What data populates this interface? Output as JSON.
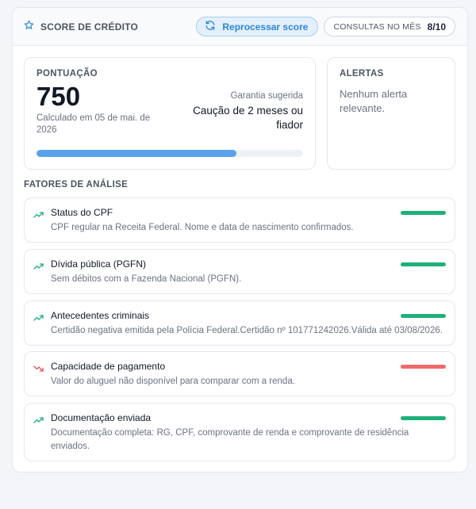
{
  "header": {
    "title": "SCORE DE CRÉDITO",
    "reprocess_label": "Reprocessar score",
    "consult_label": "CONSULTAS NO MÊS",
    "consult_value": "8/10"
  },
  "score": {
    "label": "PONTUAÇÃO",
    "value": "750",
    "date": "Calculado em 05 de mai. de 2026",
    "guarantee_label": "Garantia sugerida",
    "guarantee_value": "Caução de 2 meses ou fiador",
    "progress": 0.75
  },
  "alerts": {
    "label": "ALERTAS",
    "text": "Nenhum alerta relevante."
  },
  "factors_title": "FATORES DE ANÁLISE",
  "factors": [
    {
      "name": "Status do CPF",
      "desc": "CPF regular na Receita Federal. Nome e data de nascimento confirmados.",
      "trend": "up",
      "status_color": "#1fb07a"
    },
    {
      "name": "Dívida pública (PGFN)",
      "desc": "Sem débitos com a Fazenda Nacional (PGFN).",
      "trend": "up",
      "status_color": "#1fb07a"
    },
    {
      "name": "Antecedentes criminais",
      "desc": "Certidão negativa emitida pela Polícia Federal.Certidão nº 101771242026.Válida até 03/08/2026.",
      "trend": "up",
      "status_color": "#1fb07a"
    },
    {
      "name": "Capacidade de pagamento",
      "desc": "Valor do aluguel não disponível para comparar com a renda.",
      "trend": "down",
      "status_color": "#ef6b6b"
    },
    {
      "name": "Documentação enviada",
      "desc": "Documentação completa: RG, CPF, comprovante de renda e comprovante de residência enviados.",
      "trend": "up",
      "status_color": "#1fb07a"
    }
  ],
  "colors": {
    "accent": "#2f86d8",
    "positive": "#1fb07a",
    "negative": "#ef6b6b",
    "progress": "#5aa2ec"
  },
  "icons": {
    "header": "star-icon",
    "reprocess": "refresh-icon",
    "trend_up": "trending-up-icon",
    "trend_down": "trending-down-icon"
  }
}
